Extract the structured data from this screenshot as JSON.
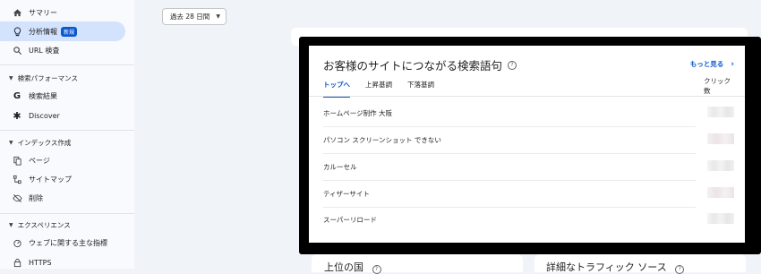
{
  "sidebar": {
    "top_items": [
      {
        "label": "サマリー",
        "icon": "home-icon"
      },
      {
        "label": "分析情報",
        "icon": "lightbulb-icon",
        "badge": "新規",
        "active": true
      },
      {
        "label": "URL 検査",
        "icon": "search-icon"
      }
    ],
    "sections": [
      {
        "title": "検索パフォーマンス",
        "items": [
          {
            "label": "検索結果",
            "icon": "google-g-icon"
          },
          {
            "label": "Discover",
            "icon": "asterisk-icon"
          }
        ]
      },
      {
        "title": "インデックス作成",
        "items": [
          {
            "label": "ページ",
            "icon": "pages-icon"
          },
          {
            "label": "サイトマップ",
            "icon": "sitemap-icon"
          },
          {
            "label": "削除",
            "icon": "eye-off-icon"
          }
        ]
      },
      {
        "title": "エクスペリエンス",
        "items": [
          {
            "label": "ウェブに関する主な指標",
            "icon": "gauge-icon"
          },
          {
            "label": "HTTPS",
            "icon": "lock-icon"
          }
        ]
      }
    ]
  },
  "date_range": "過去 28 日間",
  "card": {
    "title": "お客様のサイトにつながる検索語句",
    "more": "もっと見る",
    "tabs": [
      "トップへ",
      "上昇基調",
      "下落基調"
    ],
    "column_header": "クリック数",
    "rows": [
      "ホームページ制作 大阪",
      "パソコン スクリーンショット できない",
      "カルーセル",
      "ティザーサイト",
      "スーパーリロード"
    ]
  },
  "bottom": {
    "left_title": "上位の国",
    "right_title": "詳細なトラフィック ソース"
  },
  "colors": {
    "accent": "#0b57d0",
    "active_bg": "#d3e3fd",
    "frame": "#000000"
  }
}
